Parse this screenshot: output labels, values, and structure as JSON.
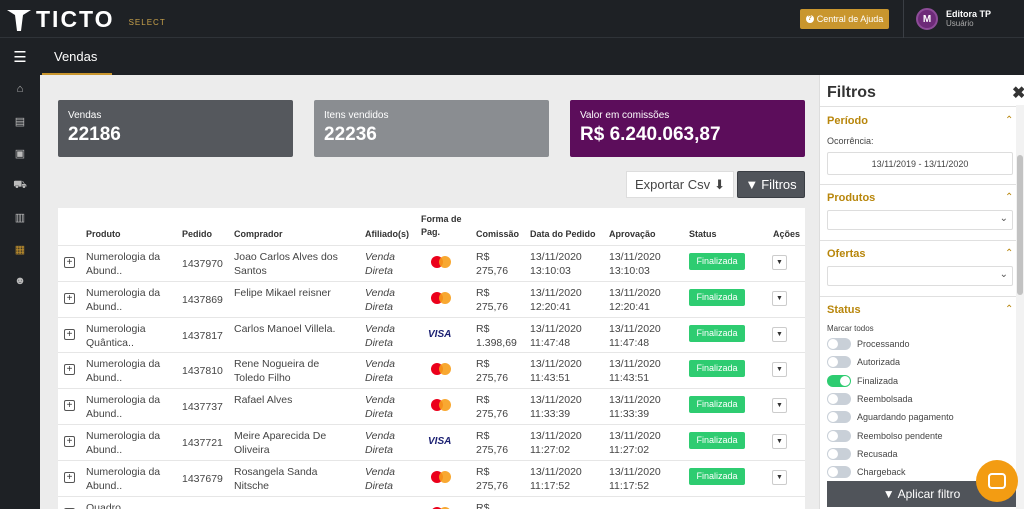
{
  "header": {
    "logo_text": "TICTO",
    "logo_sub": "SELECT",
    "help_label": "Central de Ajuda",
    "user_initial": "M",
    "user_name": "Editora TP",
    "user_role": "Usuário",
    "active_tab": "Vendas"
  },
  "cards": [
    {
      "title": "Vendas",
      "value": "22186",
      "color": "#55585d"
    },
    {
      "title": "Itens vendidos",
      "value": "22236",
      "color": "#8a8d91"
    },
    {
      "title": "Valor em comissões",
      "value": "R$ 6.240.063,87",
      "color": "#5c0d5b"
    }
  ],
  "actions": {
    "export_label": "Exportar Csv",
    "filter_label": "Filtros"
  },
  "table": {
    "headers": [
      "Produto",
      "Pedido",
      "Comprador",
      "Afiliado(s)",
      "Forma de Pag.",
      "Comissão",
      "Data do Pedido",
      "Aprovação",
      "Status",
      "Ações"
    ],
    "rows": [
      {
        "produto": [
          "Numerologia da",
          "Abund.."
        ],
        "pedido": "1437970",
        "comprador": [
          "Joao Carlos Alves dos",
          "Santos"
        ],
        "afiliado": [
          "Venda",
          "Direta"
        ],
        "pag": "mastercard",
        "comissao": [
          "R$",
          "275,76"
        ],
        "data": [
          "13/11/2020",
          "13:10:03"
        ],
        "aprov": [
          "13/11/2020",
          "13:10:03"
        ],
        "status": "Finalizada"
      },
      {
        "produto": [
          "Numerologia da",
          "Abund.."
        ],
        "pedido": "1437869",
        "comprador": [
          "Felipe Mikael reisner",
          ""
        ],
        "afiliado": [
          "Venda",
          "Direta"
        ],
        "pag": "mastercard",
        "comissao": [
          "R$",
          "275,76"
        ],
        "data": [
          "13/11/2020",
          "12:20:41"
        ],
        "aprov": [
          "13/11/2020",
          "12:20:41"
        ],
        "status": "Finalizada"
      },
      {
        "produto": [
          "Numerologia",
          "Quântica.."
        ],
        "pedido": "1437817",
        "comprador": [
          "Carlos Manoel Villela.",
          ""
        ],
        "afiliado": [
          "Venda",
          "Direta"
        ],
        "pag": "visa",
        "comissao": [
          "R$",
          "1.398,69"
        ],
        "data": [
          "13/11/2020",
          "11:47:48"
        ],
        "aprov": [
          "13/11/2020",
          "11:47:48"
        ],
        "status": "Finalizada"
      },
      {
        "produto": [
          "Numerologia da",
          "Abund.."
        ],
        "pedido": "1437810",
        "comprador": [
          "Rene Nogueira de",
          "Toledo Filho"
        ],
        "afiliado": [
          "Venda",
          "Direta"
        ],
        "pag": "mastercard",
        "comissao": [
          "R$",
          "275,76"
        ],
        "data": [
          "13/11/2020",
          "11:43:51"
        ],
        "aprov": [
          "13/11/2020",
          "11:43:51"
        ],
        "status": "Finalizada"
      },
      {
        "produto": [
          "Numerologia da",
          "Abund.."
        ],
        "pedido": "1437737",
        "comprador": [
          "Rafael Alves",
          ""
        ],
        "afiliado": [
          "Venda",
          "Direta"
        ],
        "pag": "mastercard",
        "comissao": [
          "R$",
          "275,76"
        ],
        "data": [
          "13/11/2020",
          "11:33:39"
        ],
        "aprov": [
          "13/11/2020",
          "11:33:39"
        ],
        "status": "Finalizada"
      },
      {
        "produto": [
          "Numerologia da",
          "Abund.."
        ],
        "pedido": "1437721",
        "comprador": [
          "Meire Aparecida De",
          "Oliveira"
        ],
        "afiliado": [
          "Venda",
          "Direta"
        ],
        "pag": "visa",
        "comissao": [
          "R$",
          "275,76"
        ],
        "data": [
          "13/11/2020",
          "11:27:02"
        ],
        "aprov": [
          "13/11/2020",
          "11:27:02"
        ],
        "status": "Finalizada"
      },
      {
        "produto": [
          "Numerologia da",
          "Abund.."
        ],
        "pedido": "1437679",
        "comprador": [
          "Rosangela Sanda",
          "Nitsche"
        ],
        "afiliado": [
          "Venda",
          "Direta"
        ],
        "pag": "mastercard",
        "comissao": [
          "R$",
          "275,76"
        ],
        "data": [
          "13/11/2020",
          "11:17:52"
        ],
        "aprov": [
          "13/11/2020",
          "11:17:52"
        ],
        "status": "Finalizada"
      },
      {
        "produto": [
          "Quadro",
          ""
        ],
        "pedido": "",
        "comprador": [
          "",
          ""
        ],
        "afiliado": [
          "",
          ""
        ],
        "pag": "mastercard",
        "comissao": [
          "R$",
          ""
        ],
        "data": [
          "",
          ""
        ],
        "aprov": [
          "",
          ""
        ],
        "status": ""
      }
    ]
  },
  "filters": {
    "title": "Filtros",
    "close": "✖",
    "periodo_title": "Período",
    "ocorrencia_label": "Ocorrência:",
    "date_range": "13/11/2019 - 13/11/2020",
    "produtos_title": "Produtos",
    "ofertas_title": "Ofertas",
    "status_title": "Status",
    "marcar_todos": "Marcar todos",
    "status_options": [
      {
        "label": "Processando",
        "on": false
      },
      {
        "label": "Autorizada",
        "on": false
      },
      {
        "label": "Finalizada",
        "on": true
      },
      {
        "label": "Reembolsada",
        "on": false
      },
      {
        "label": "Aguardando pagamento",
        "on": false
      },
      {
        "label": "Reembolso pendente",
        "on": false
      },
      {
        "label": "Recusada",
        "on": false
      },
      {
        "label": "Chargeback",
        "on": false
      }
    ],
    "apply_label": "Aplicar filtro"
  }
}
